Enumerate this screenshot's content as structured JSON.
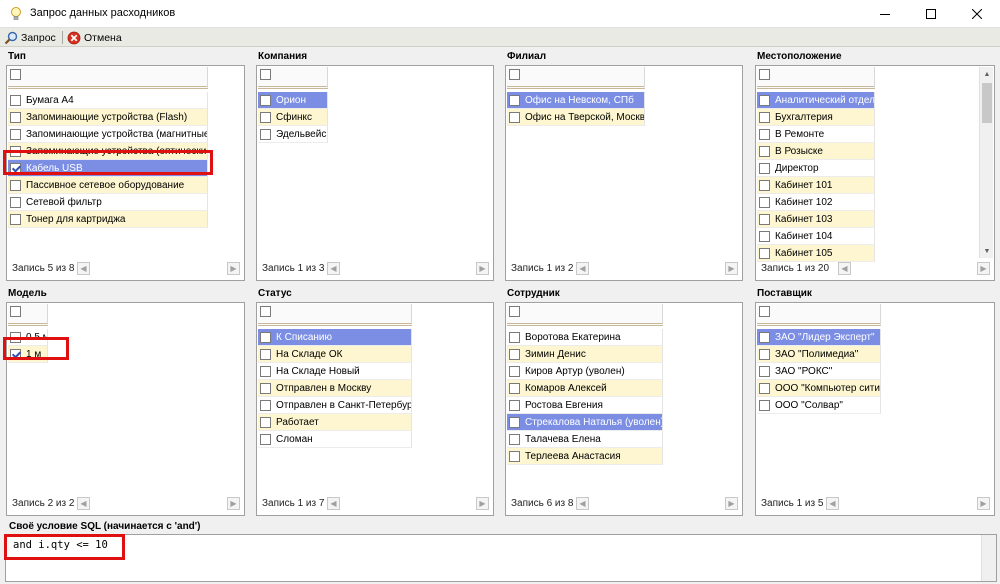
{
  "window": {
    "title": "Запрос данных расходников",
    "accent": "#e01010"
  },
  "toolbar": {
    "query_label": "Запрос",
    "cancel_label": "Отмена"
  },
  "panels": {
    "type": {
      "title": "Тип",
      "record": "Запись 5 из 8",
      "items": [
        {
          "label": "Бумага А4",
          "checked": false,
          "selected": false
        },
        {
          "label": "Запоминающие устройства (Flash)",
          "checked": false,
          "selected": false
        },
        {
          "label": "Запоминающие устройства (магнитные)",
          "checked": false,
          "selected": false
        },
        {
          "label": "Запоминающие устройства (оптические)",
          "checked": false,
          "selected": false
        },
        {
          "label": "Кабель USB",
          "checked": true,
          "selected": true
        },
        {
          "label": "Пассивное сетевое оборудование",
          "checked": false,
          "selected": false
        },
        {
          "label": "Сетевой фильтр",
          "checked": false,
          "selected": false
        },
        {
          "label": "Тонер для картриджа",
          "checked": false,
          "selected": false
        }
      ]
    },
    "company": {
      "title": "Компания",
      "record": "Запись 1 из 3",
      "items": [
        {
          "label": "Орион",
          "checked": false,
          "selected": true
        },
        {
          "label": "Сфинкс",
          "checked": false,
          "selected": false
        },
        {
          "label": "Эдельвейс",
          "checked": false,
          "selected": false
        }
      ]
    },
    "branch": {
      "title": "Филиал",
      "record": "Запись 1 из 2",
      "items": [
        {
          "label": "Офис на Невском, СПб",
          "checked": false,
          "selected": true
        },
        {
          "label": "Офис на Тверской, Москва",
          "checked": false,
          "selected": false
        }
      ]
    },
    "location": {
      "title": "Местоположение",
      "record": "Запись 1 из 20",
      "items": [
        {
          "label": "Аналитический отдел",
          "checked": false,
          "selected": true
        },
        {
          "label": "Бухгалтерия",
          "checked": false,
          "selected": false
        },
        {
          "label": "В Ремонте",
          "checked": false,
          "selected": false
        },
        {
          "label": "В Розыске",
          "checked": false,
          "selected": false
        },
        {
          "label": "Директор",
          "checked": false,
          "selected": false
        },
        {
          "label": "Кабинет 101",
          "checked": false,
          "selected": false
        },
        {
          "label": "Кабинет 102",
          "checked": false,
          "selected": false
        },
        {
          "label": "Кабинет 103",
          "checked": false,
          "selected": false
        },
        {
          "label": "Кабинет 104",
          "checked": false,
          "selected": false
        },
        {
          "label": "Кабинет 105",
          "checked": false,
          "selected": false
        }
      ]
    },
    "model": {
      "title": "Модель",
      "record": "Запись 2 из 2",
      "items": [
        {
          "label": "0.5 м",
          "checked": false,
          "selected": false
        },
        {
          "label": "1 м",
          "checked": true,
          "selected": false
        }
      ]
    },
    "status": {
      "title": "Статус",
      "record": "Запись 1 из 7",
      "items": [
        {
          "label": "К Списанию",
          "checked": false,
          "selected": true
        },
        {
          "label": "На Складе ОК",
          "checked": false,
          "selected": false
        },
        {
          "label": "На Складе Новый",
          "checked": false,
          "selected": false
        },
        {
          "label": "Отправлен в Москву",
          "checked": false,
          "selected": false
        },
        {
          "label": "Отправлен в Санкт-Петербург",
          "checked": false,
          "selected": false
        },
        {
          "label": "Работает",
          "checked": false,
          "selected": false
        },
        {
          "label": "Сломан",
          "checked": false,
          "selected": false
        }
      ]
    },
    "employee": {
      "title": "Сотрудник",
      "record": "Запись 6 из 8",
      "items": [
        {
          "label": "Воротова Екатерина",
          "checked": false,
          "selected": false
        },
        {
          "label": "Зимин Денис",
          "checked": false,
          "selected": false
        },
        {
          "label": "Киров Артур  (уволен)",
          "checked": false,
          "selected": false
        },
        {
          "label": "Комаров Алексей",
          "checked": false,
          "selected": false
        },
        {
          "label": "Ростова Евгения",
          "checked": false,
          "selected": false
        },
        {
          "label": "Стрекалова Наталья  (уволен)",
          "checked": false,
          "selected": true
        },
        {
          "label": "Талачева Елена",
          "checked": false,
          "selected": false
        },
        {
          "label": "Терлеева Анастасия",
          "checked": false,
          "selected": false
        }
      ]
    },
    "supplier": {
      "title": "Поставщик",
      "record": "Запись 1 из 5",
      "items": [
        {
          "label": "ЗАО \"Лидер Эксперт\"",
          "checked": false,
          "selected": true
        },
        {
          "label": "ЗАО \"Полимедиа\"",
          "checked": false,
          "selected": false
        },
        {
          "label": "ЗАО \"РОКС\"",
          "checked": false,
          "selected": false
        },
        {
          "label": "ООО \"Компьютер сити\"",
          "checked": false,
          "selected": false
        },
        {
          "label": "ООО \"Солвар\"",
          "checked": false,
          "selected": false
        }
      ]
    }
  },
  "sql": {
    "label": "Своё условие SQL (начинается с 'and')",
    "value": "and i.qty <= 10"
  }
}
